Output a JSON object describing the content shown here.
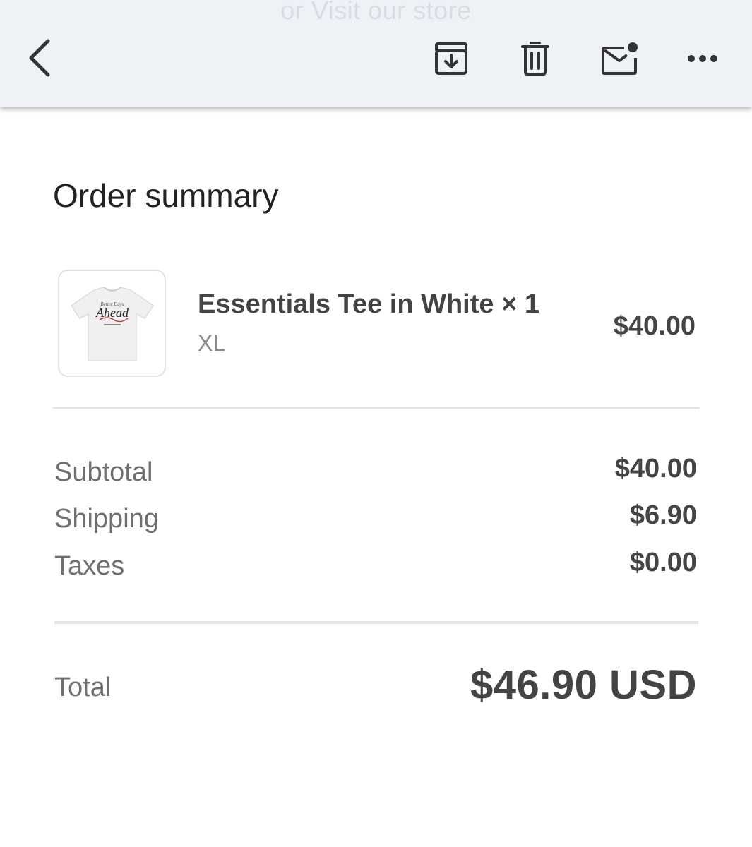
{
  "header": {
    "ghost_text": "or Visit our store",
    "actions": {
      "back": "back-icon",
      "archive": "archive-icon",
      "delete": "trash-icon",
      "mark_unread": "mail-unread-icon",
      "more": "more-horizontal-icon"
    }
  },
  "order": {
    "title": "Order summary",
    "item": {
      "name": "Essentials Tee in White × 1",
      "variant": "XL",
      "price": "$40.00",
      "image_text": "Ahead"
    },
    "breakdown": [
      {
        "label": "Subtotal",
        "value": "$40.00"
      },
      {
        "label": "Shipping",
        "value": "$6.90"
      },
      {
        "label": "Taxes",
        "value": "$0.00"
      }
    ],
    "total": {
      "label": "Total",
      "value": "$46.90 USD"
    }
  },
  "colors": {
    "toolbar_bg": "#eef2f7",
    "icon": "#333333",
    "text_primary": "#222222",
    "text_secondary": "#6f6f6f"
  }
}
